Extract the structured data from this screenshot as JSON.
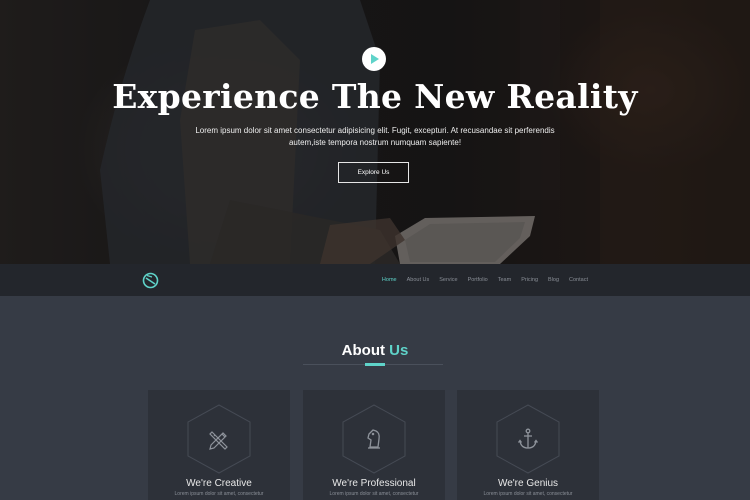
{
  "hero": {
    "title": "Experience The New Reality",
    "text": "Lorem ipsum dolor sit amet consectetur adipisicing elit. Fugit, excepturi. At recusandae sit perferendis autem,iste tempora nostrum numquam sapiente!",
    "cta_label": "Explore Us",
    "play_icon": "play-icon"
  },
  "nav": {
    "logo_icon": "compass-logo-icon",
    "items": [
      {
        "label": "Home",
        "active": true
      },
      {
        "label": "About Us"
      },
      {
        "label": "Service"
      },
      {
        "label": "Portfolio"
      },
      {
        "label": "Team"
      },
      {
        "label": "Pricing"
      },
      {
        "label": "Blog"
      },
      {
        "label": "Contact"
      }
    ]
  },
  "about": {
    "title_main": "About",
    "title_accent": "Us",
    "cards": [
      {
        "title": "We're Creative",
        "icon": "pencil-ruler-icon",
        "text": "Lorem ipsum dolor sit amet, consectetur"
      },
      {
        "title": "We're Professional",
        "icon": "chess-knight-icon",
        "text": "Lorem ipsum dolor sit amet, consectetur"
      },
      {
        "title": "We're Genius",
        "icon": "anchor-icon",
        "text": "Lorem ipsum dolor sit amet, consectetur"
      }
    ]
  },
  "colors": {
    "accent": "#5fd3c9",
    "navbar_bg": "#23262c",
    "section_bg": "#363b45",
    "card_bg": "#2d3139"
  }
}
